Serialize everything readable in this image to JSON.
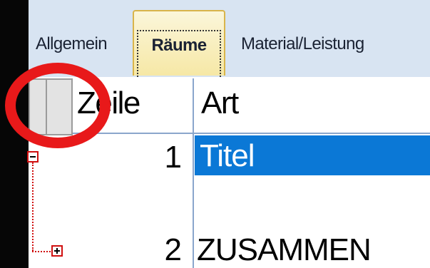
{
  "tabs": [
    {
      "label": "Allgemein",
      "active": false
    },
    {
      "label": "Räume",
      "active": true
    },
    {
      "label": "Material/Leistung",
      "active": false
    }
  ],
  "grid": {
    "columns": [
      {
        "label": "Zeile"
      },
      {
        "label": "Art"
      }
    ],
    "rows": [
      {
        "zeile": "1",
        "art": "Titel",
        "selected": true,
        "expander": "minus"
      },
      {
        "zeile": "2",
        "art": "ZUSAMMEN",
        "selected": false,
        "expander": "plus"
      }
    ]
  },
  "colors": {
    "tab_bar": "#d8e4f2",
    "active_tab": "#f6e8a6",
    "selection": "#0b78d6",
    "annotation_ring": "#e8191a"
  }
}
